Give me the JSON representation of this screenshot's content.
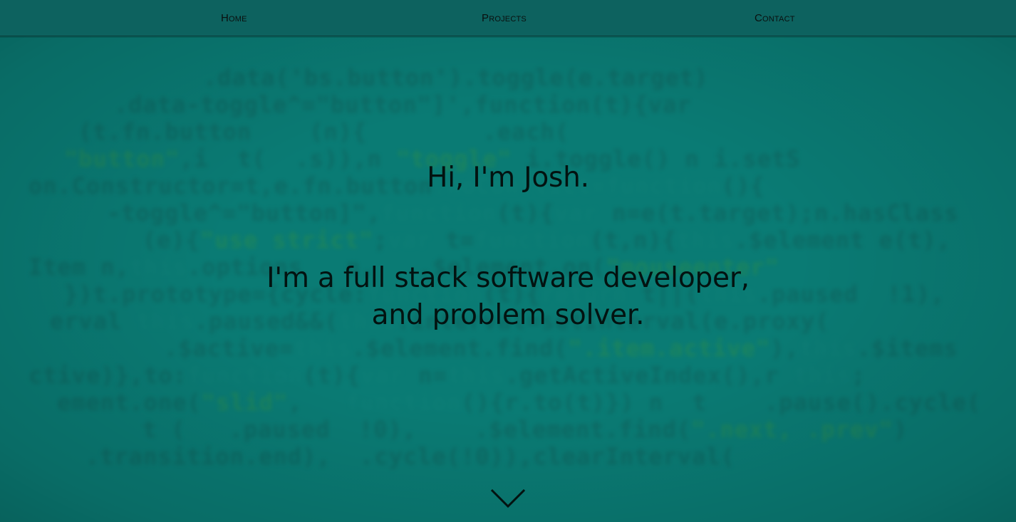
{
  "colors": {
    "hero_background": "#0a7b74",
    "nav_background": "#0d625f",
    "text": "#031210"
  },
  "nav": {
    "items": [
      {
        "label": "Home"
      },
      {
        "label": "Projects"
      },
      {
        "label": "Contact"
      }
    ]
  },
  "hero": {
    "title": "Hi, I'm Josh.",
    "subtitle_line1": "I'm a full stack software developer,",
    "subtitle_line2": "and problem solver."
  },
  "icons": {
    "scroll_down": "chevron-down-icon"
  }
}
